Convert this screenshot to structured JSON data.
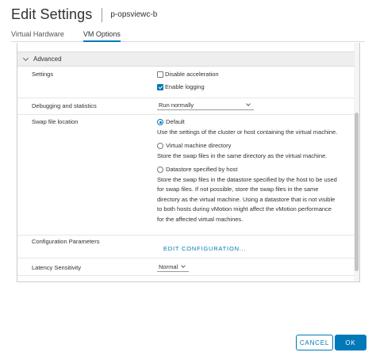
{
  "header": {
    "title": "Edit Settings",
    "vm_name": "p-opsviewc-b"
  },
  "tabs": [
    {
      "label": "Virtual Hardware",
      "active": false
    },
    {
      "label": "VM Options",
      "active": true
    }
  ],
  "section": {
    "title": "Advanced",
    "expanded": true
  },
  "settings": {
    "label": "Settings",
    "disable_acceleration": {
      "label": "Disable acceleration",
      "checked": false
    },
    "enable_logging": {
      "label": "Enable logging",
      "checked": true
    }
  },
  "debugging": {
    "label": "Debugging and statistics",
    "selected": "Run normally"
  },
  "swap": {
    "label": "Swap file location",
    "options": [
      {
        "label": "Default",
        "checked": true,
        "desc_lines": [
          "Use the settings of the cluster or host containing the virtual machine."
        ]
      },
      {
        "label": "Virtual machine directory",
        "checked": false,
        "desc_lines": [
          "Store the swap files in the same directory as the virtual machine."
        ]
      },
      {
        "label": "Datastore specified by host",
        "checked": false,
        "desc_lines": [
          "Store the swap files in the datastore specified by the host to be used",
          "for swap files. If not possible, store the swap files in the same",
          "directory as the virtual machine. Using a datastore that is not visible",
          "to both hosts during vMotion might affect the vMotion performance",
          "for the affected virtual machines."
        ]
      }
    ]
  },
  "config_params": {
    "label": "Configuration Parameters",
    "button": "EDIT CONFIGURATION..."
  },
  "latency": {
    "label": "Latency Sensitivity",
    "selected": "Normal"
  },
  "footer": {
    "cancel": "CANCEL",
    "ok": "OK"
  },
  "colors": {
    "accent": "#0079b8"
  }
}
